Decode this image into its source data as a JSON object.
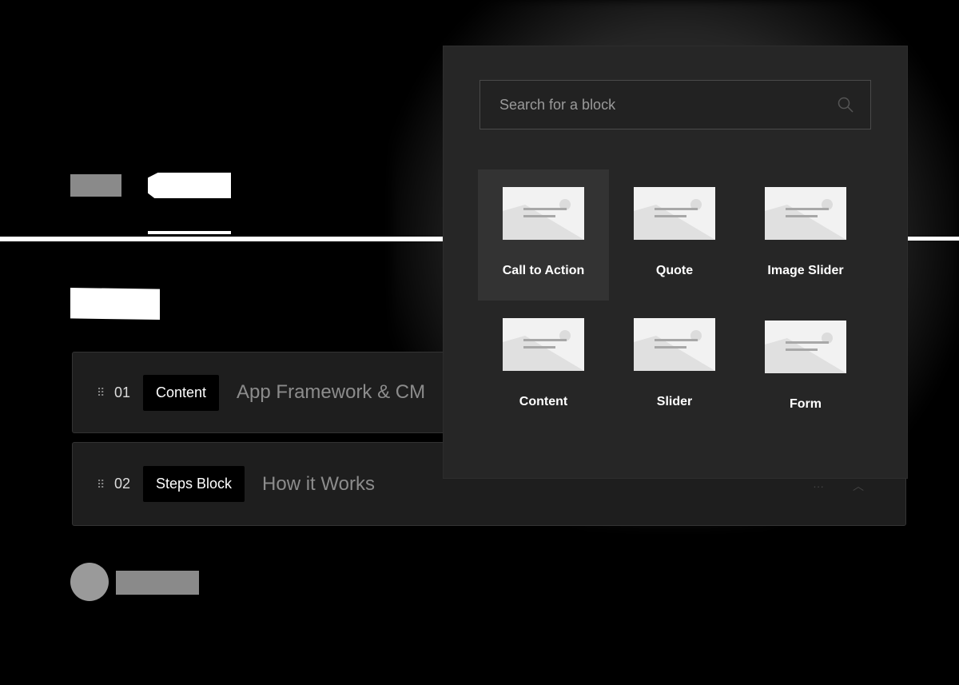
{
  "search": {
    "placeholder": "Search for a block"
  },
  "blocks": [
    {
      "label": "Call to Action"
    },
    {
      "label": "Quote"
    },
    {
      "label": "Image Slider"
    },
    {
      "label": "Content"
    },
    {
      "label": "Slider"
    },
    {
      "label": "Form"
    }
  ],
  "rows": [
    {
      "number": "01",
      "type": "Content",
      "title": "App Framework & CM"
    },
    {
      "number": "02",
      "type": "Steps Block",
      "title": "How it Works"
    }
  ],
  "row_actions": {
    "more_icon": "ellipsis-icon",
    "collapse_icon": "chevron-up-icon"
  },
  "colors": {
    "panel": "#262626",
    "row": "#1e1e1e",
    "active_tile": "#333333",
    "chip": "#000000"
  }
}
